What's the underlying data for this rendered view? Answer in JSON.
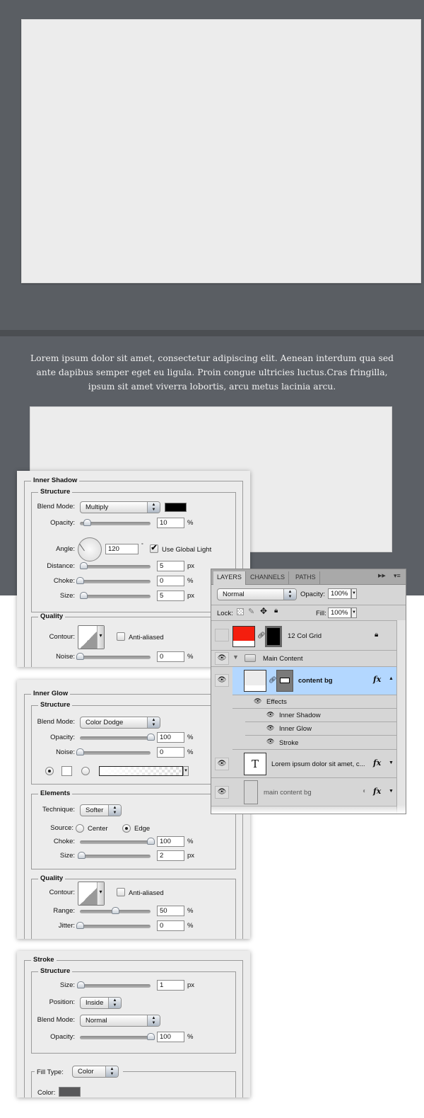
{
  "page": {
    "lorem": "Lorem ipsum dolor sit amet, consectetur adipiscing elit. Aenean interdum qua sed ante dapibus semper eget eu ligula. Proin congue ultricies luctus.Cras fringilla, ipsum sit amet viverra lobortis, arcu metus lacinia arcu.",
    "background_color": "#5a5e63",
    "panel_color": "#ececec"
  },
  "inner_shadow": {
    "title": "Inner Shadow",
    "structure": "Structure",
    "blend_label": "Blend Mode:",
    "blend_value": "Multiply",
    "color": "#000000",
    "opacity": {
      "label": "Opacity:",
      "value": "10",
      "unit": "%",
      "pos": 0.1
    },
    "angle": {
      "label": "Angle:",
      "value": "120",
      "unit": "°",
      "global_light": "Use Global Light",
      "checked": true
    },
    "distance": {
      "label": "Distance:",
      "value": "5",
      "unit": "px",
      "pos": 0.05
    },
    "choke": {
      "label": "Choke:",
      "value": "0",
      "unit": "%",
      "pos": 0
    },
    "size": {
      "label": "Size:",
      "value": "5",
      "unit": "px",
      "pos": 0.05
    },
    "quality": "Quality",
    "contour_label": "Contour:",
    "anti_aliased": "Anti-aliased",
    "noise": {
      "label": "Noise:",
      "value": "0",
      "unit": "%",
      "pos": 0
    }
  },
  "inner_glow": {
    "title": "Inner Glow",
    "structure": "Structure",
    "blend_label": "Blend Mode:",
    "blend_value": "Color Dodge",
    "opacity": {
      "label": "Opacity:",
      "value": "100",
      "unit": "%",
      "pos": 1
    },
    "noise": {
      "label": "Noise:",
      "value": "0",
      "unit": "%",
      "pos": 0
    },
    "glow_color": "#ffffff",
    "elements": "Elements",
    "technique_label": "Technique:",
    "technique_value": "Softer",
    "source_label": "Source:",
    "source_center": "Center",
    "source_edge": "Edge",
    "choke": {
      "label": "Choke:",
      "value": "100",
      "unit": "%",
      "pos": 1
    },
    "size": {
      "label": "Size:",
      "value": "2",
      "unit": "px",
      "pos": 0.02
    },
    "quality": "Quality",
    "contour_label": "Contour:",
    "anti_aliased": "Anti-aliased",
    "range": {
      "label": "Range:",
      "value": "50",
      "unit": "%",
      "pos": 0.5
    },
    "jitter": {
      "label": "Jitter:",
      "value": "0",
      "unit": "%",
      "pos": 0
    }
  },
  "stroke": {
    "title": "Stroke",
    "structure": "Structure",
    "size": {
      "label": "Size:",
      "value": "1",
      "unit": "px",
      "pos": 0.01
    },
    "position_label": "Position:",
    "position_value": "Inside",
    "blend_label": "Blend Mode:",
    "blend_value": "Normal",
    "opacity": {
      "label": "Opacity:",
      "value": "100",
      "unit": "%",
      "pos": 1
    },
    "fill_type_label": "Fill Type:",
    "fill_type_value": "Color",
    "color_label": "Color:",
    "color": "#58585a"
  },
  "layers": {
    "tabs": [
      "LAYERS",
      "CHANNELS",
      "PATHS"
    ],
    "blend_value": "Normal",
    "opacity_label": "Opacity:",
    "opacity_value": "100%",
    "lock_label": "Lock:",
    "fill_label": "Fill:",
    "fill_value": "100%",
    "items": [
      {
        "name": "12 Col Grid"
      },
      {
        "name": "Main Content"
      },
      {
        "name": "content bg",
        "fx": "fx"
      },
      {
        "name": "Effects"
      },
      {
        "name": "Inner Shadow"
      },
      {
        "name": "Inner Glow"
      },
      {
        "name": "Stroke"
      },
      {
        "name": "Lorem ipsum dolor sit amet, c...",
        "fx": "fx",
        "thumb": "T"
      },
      {
        "name": "main content bg",
        "fx": "fx"
      }
    ],
    "selected_color": "#b3d7ff"
  }
}
